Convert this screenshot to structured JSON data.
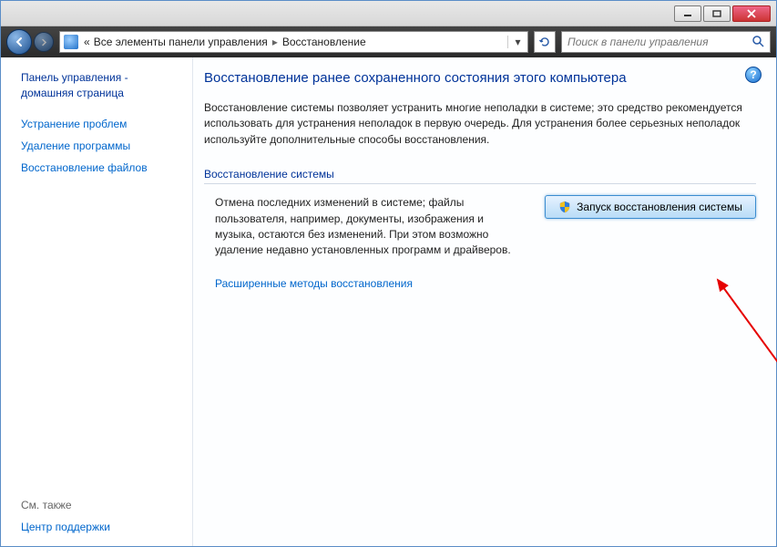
{
  "titlebar": {
    "min": "―",
    "max": "▢",
    "close": "✕"
  },
  "breadcrumb": {
    "prefix": "«",
    "item1": "Все элементы панели управления",
    "item2": "Восстановление",
    "arrow": "▸"
  },
  "search": {
    "placeholder": "Поиск в панели управления"
  },
  "sidebar": {
    "home": "Панель управления - домашняя страница",
    "link1": "Устранение проблем",
    "link2": "Удаление программы",
    "link3": "Восстановление файлов",
    "seealso_label": "См. также",
    "seealso_link": "Центр поддержки"
  },
  "main": {
    "heading": "Восстановление ранее сохраненного состояния этого компьютера",
    "paragraph": "Восстановление системы позволяет устранить многие неполадки в системе; это средство рекомендуется использовать для устранения неполадок в первую очередь. Для устранения более серьезных неполадок используйте дополнительные способы восстановления.",
    "section_title": "Восстановление системы",
    "section_desc": "Отмена последних изменений в системе; файлы пользователя, например, документы, изображения и музыка, остаются без изменений. При этом возможно удаление недавно установленных программ и драйверов.",
    "button_label": "Запуск восстановления системы",
    "adv_link": "Расширенные методы восстановления"
  }
}
